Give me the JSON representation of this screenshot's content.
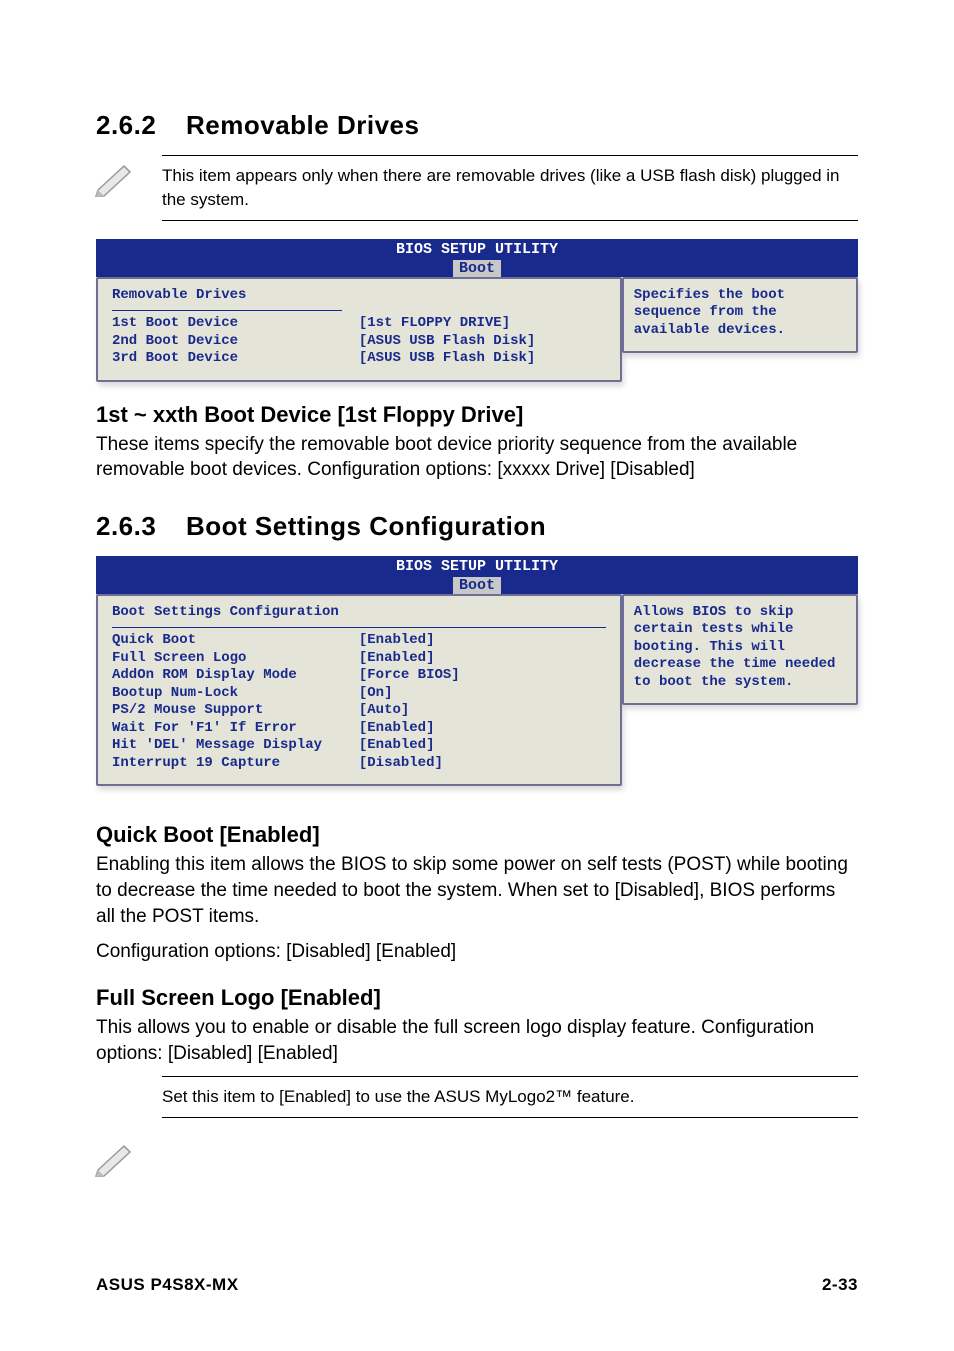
{
  "s262": {
    "num": "2.6.2",
    "title": "Removable Drives",
    "note": "This item appears only when there are removable drives (like a USB flash disk) plugged in the system.",
    "bios": {
      "utility": "BIOS SETUP UTILITY",
      "tab": "Boot",
      "header": "Removable Drives",
      "rows": [
        {
          "label": "1st Boot Device",
          "value": "[1st FLOPPY DRIVE]"
        },
        {
          "label": "2nd Boot Device",
          "value": "[ASUS USB Flash Disk]"
        },
        {
          "label": "3rd Boot Device",
          "value": "[ASUS USB Flash Disk]"
        }
      ],
      "help": "Specifies the boot sequence from the available devices."
    },
    "sub1_title": "1st ~ xxth Boot Device [1st Floppy Drive]",
    "sub1_body": "These items specify the removable boot device priority sequence from the available removable boot devices. Configuration options: [xxxxx Drive] [Disabled]"
  },
  "s263": {
    "num": "2.6.3",
    "title": "Boot Settings Configuration",
    "bios": {
      "utility": "BIOS SETUP UTILITY",
      "tab": "Boot",
      "header": "Boot Settings Configuration",
      "rows": [
        {
          "label": "Quick Boot",
          "value": "[Enabled]"
        },
        {
          "label": "Full Screen Logo",
          "value": "[Enabled]"
        },
        {
          "label": "AddOn ROM Display Mode",
          "value": "[Force BIOS]"
        },
        {
          "label": "Bootup Num-Lock",
          "value": "[On]"
        },
        {
          "label": "PS/2 Mouse Support",
          "value": "[Auto]"
        },
        {
          "label": "Wait For 'F1' If Error",
          "value": "[Enabled]"
        },
        {
          "label": "Hit 'DEL' Message Display",
          "value": "[Enabled]"
        },
        {
          "label": "Interrupt 19 Capture",
          "value": "[Disabled]"
        }
      ],
      "help": "Allows BIOS to skip certain tests while booting. This will decrease the time needed to boot the system."
    },
    "quickboot": {
      "title": "Quick Boot [Enabled]",
      "body1": "Enabling this item allows the BIOS to skip some power on self tests (POST) while booting to decrease the time needed to boot the system. When set to [Disabled], BIOS performs all the POST items.",
      "body2": "Configuration options: [Disabled] [Enabled]"
    },
    "fullscreen": {
      "title": "Full Screen Logo [Enabled]",
      "body1": "This allows you to enable or disable the full screen logo display feature. Configuration options: [Disabled] [Enabled]"
    },
    "note": "Set this item to [Enabled] to use the ASUS MyLogo2™ feature."
  },
  "footer": {
    "left": "ASUS P4S8X-MX",
    "right": "2-33"
  }
}
